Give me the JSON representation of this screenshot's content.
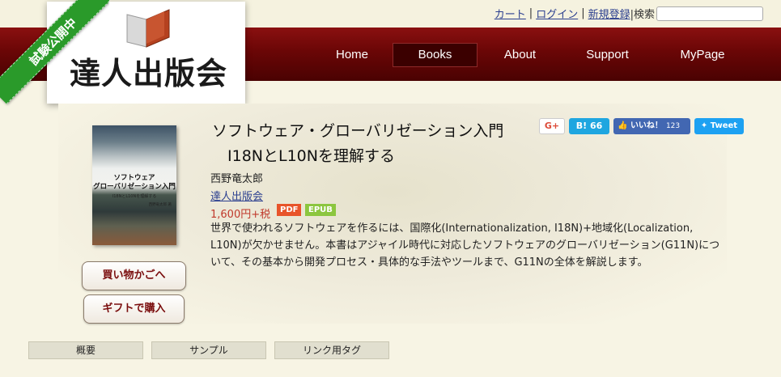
{
  "ribbon": {
    "label": "試験公開中"
  },
  "logo": {
    "text": "達人出版会"
  },
  "toplinks": {
    "cart": "カート",
    "login": "ログイン",
    "register": "新規登録",
    "search_label": "|検索",
    "search_value": ""
  },
  "nav": {
    "items": [
      {
        "label": "Home"
      },
      {
        "label": "Books"
      },
      {
        "label": "About"
      },
      {
        "label": "Support"
      },
      {
        "label": "MyPage"
      }
    ],
    "active": "Books"
  },
  "book": {
    "title_line1": "ソフトウェア・グローバリゼーション入門",
    "title_line2": "I18NとL10Nを理解する",
    "author": "西野竜太郎",
    "publisher": "達人出版会",
    "price": "1,600円+税",
    "formats": [
      "PDF",
      "EPUB"
    ],
    "description": "世界で使われるソフトウェアを作るには、国際化(Internationalization, I18N)+地域化(Localization, L10N)が欠かせません。本書はアジャイル時代に対応したソフトウェアのグローバリゼーション(G11N)について、その基本から開発プロセス・具体的な手法やツールまで、G11Nの全体を解説します。",
    "cover": {
      "title_line1": "ソフトウェア",
      "title_line2": "グローバリゼーション入門",
      "subtitle": "I18NとL10Nを理解する",
      "author": "西野竜太郎 著"
    }
  },
  "buttons": {
    "cart": "買い物かごへ",
    "gift": "ギフトで購入"
  },
  "social": {
    "gplus": "G+",
    "hatena": "B! 66",
    "facebook": "いいね！",
    "facebook_count": "123",
    "tweet": "Tweet"
  },
  "tabs": [
    {
      "label": "概要"
    },
    {
      "label": "サンプル"
    },
    {
      "label": "リンク用タグ"
    }
  ],
  "colors": {
    "nav_bg": "#6a0606",
    "ribbon": "#2a9a2a",
    "pdf": "#e8542a",
    "epub": "#8cc63f",
    "price": "#c0392b",
    "link": "#2b3f8f"
  }
}
